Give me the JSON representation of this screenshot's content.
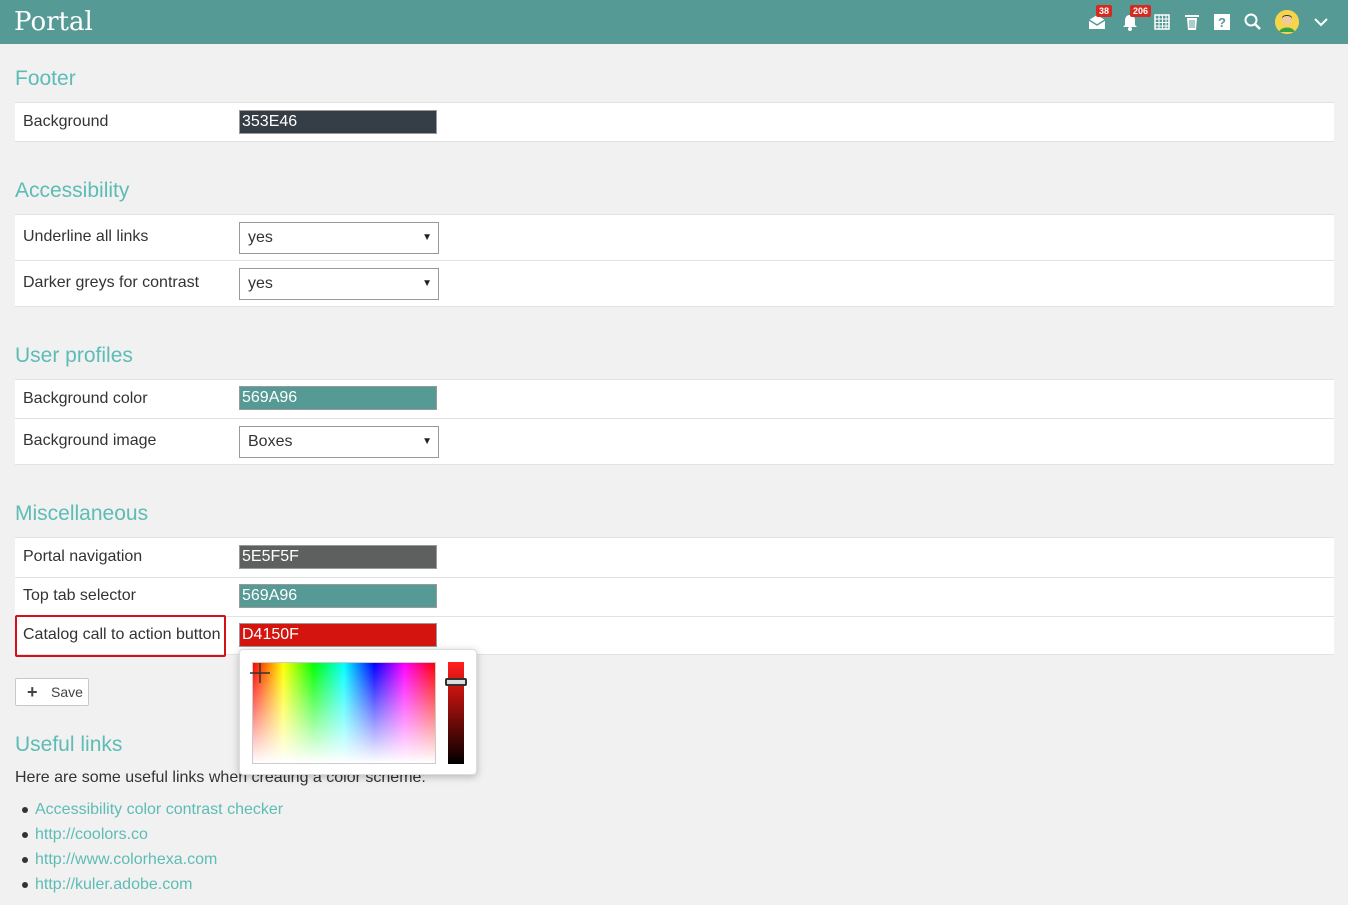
{
  "app": {
    "title": "Portal"
  },
  "header": {
    "mail_badge": "38",
    "notifications_badge": "206"
  },
  "footer_section": {
    "title": "Footer",
    "background_label": "Background",
    "background_value": "353E46",
    "background_color": "#353E46"
  },
  "accessibility": {
    "title": "Accessibility",
    "underline_label": "Underline all links",
    "underline_value": "yes",
    "darker_label": "Darker greys for contrast",
    "darker_value": "yes"
  },
  "user_profiles": {
    "title": "User profiles",
    "bg_color_label": "Background color",
    "bg_color_value": "569A96",
    "bg_color_hex": "#569A96",
    "bg_image_label": "Background image",
    "bg_image_value": "Boxes"
  },
  "misc": {
    "title": "Miscellaneous",
    "portal_nav_label": "Portal navigation",
    "portal_nav_value": "5E5F5F",
    "portal_nav_hex": "#5E5F5F",
    "top_tab_label": "Top tab selector",
    "top_tab_value": "569A96",
    "top_tab_hex": "#569A96",
    "catalog_label": "Catalog call to action button",
    "catalog_value": "D4150F",
    "catalog_hex": "#D4150F"
  },
  "save_label": "Save",
  "useful_links": {
    "title": "Useful links",
    "intro": "Here are some useful links when creating a color scheme:",
    "items": [
      {
        "label": "Accessibility color contrast checker"
      },
      {
        "label": "http://coolors.co"
      },
      {
        "label": "http://www.colorhexa.com"
      },
      {
        "label": "http://kuler.adobe.com"
      }
    ]
  }
}
